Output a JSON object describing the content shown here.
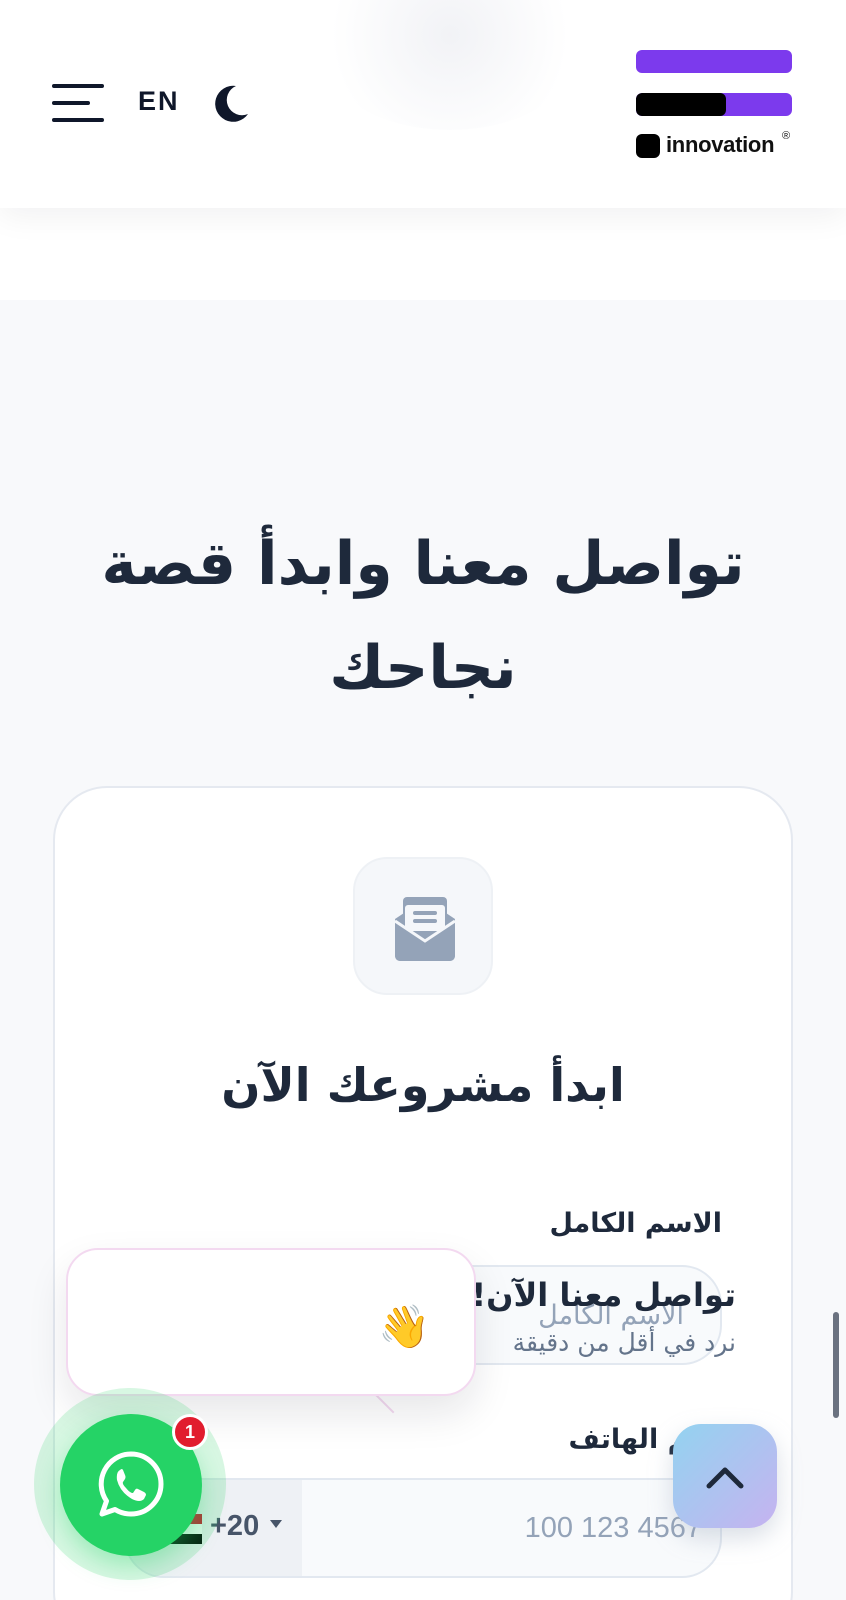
{
  "header": {
    "language_toggle": "EN",
    "logo_text": "innovation",
    "logo_mark": "®",
    "brand_color": "#7c3aed"
  },
  "section": {
    "title_line1": "تواصل معنا وابدأ قصة",
    "title_line2": "نجاحك"
  },
  "form": {
    "icon": "envelope-open-icon",
    "title": "ابدأ مشروعك الآن",
    "name_label": "الاسم الكامل",
    "name_placeholder": "الاسم الكامل",
    "phone_label": "رقم الهاتف",
    "country_code": "+20",
    "phone_placeholder": "100 123 4567"
  },
  "chat_popup": {
    "title": "تواصل معنا الآن!",
    "subtitle": "نرد في أقل من دقيقة",
    "emoji": "👋",
    "badge_count": "1",
    "accent": "#25d366"
  }
}
